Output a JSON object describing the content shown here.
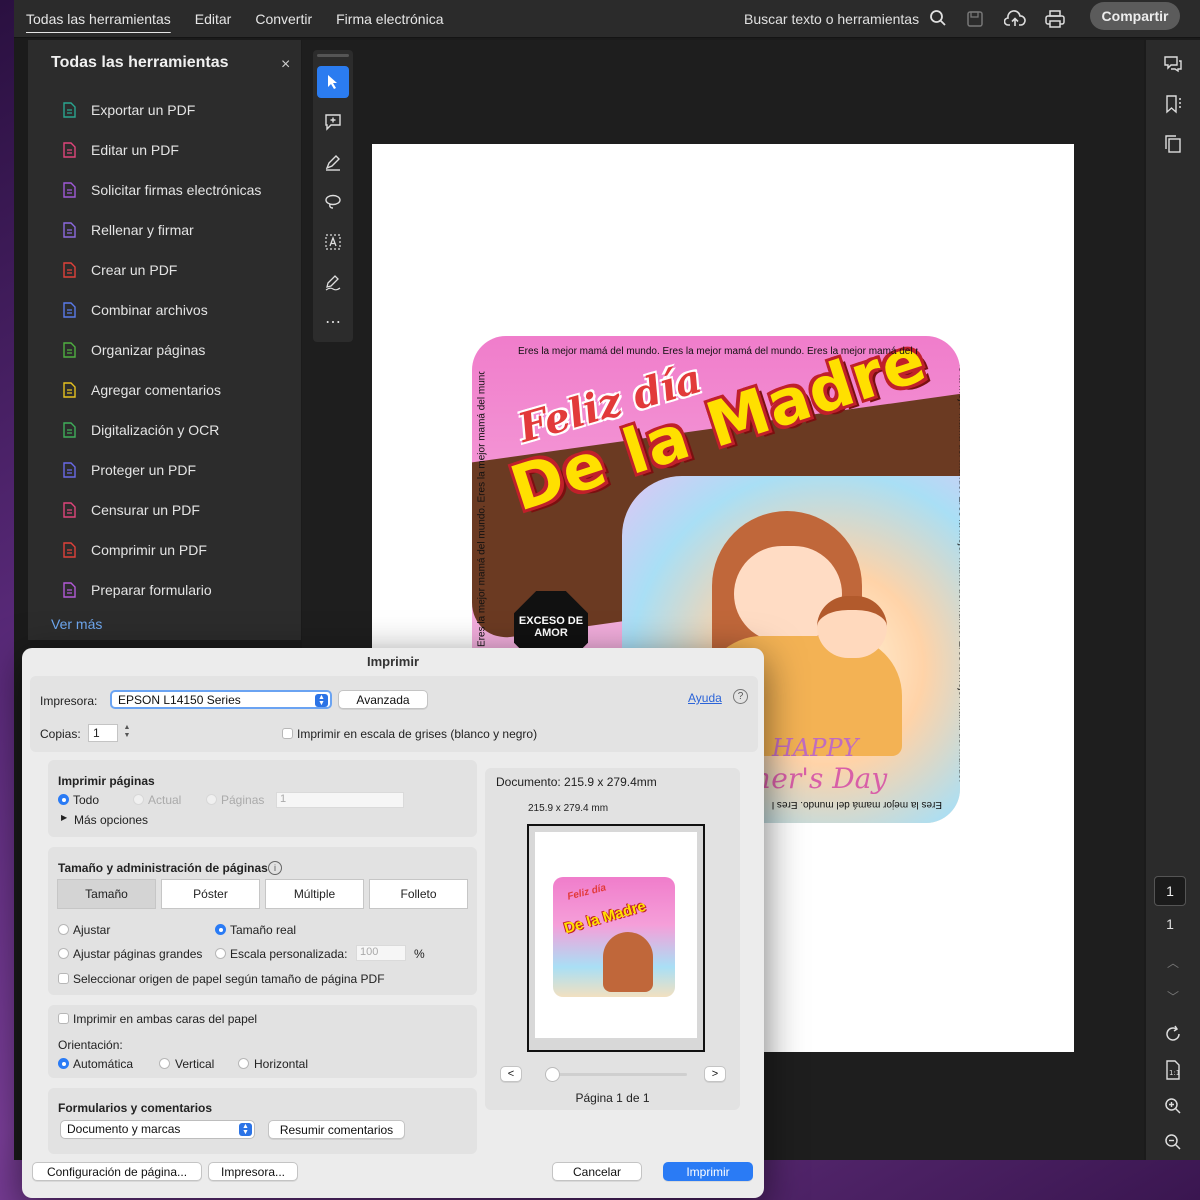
{
  "menubar": {
    "items": [
      "Todas las herramientas",
      "Editar",
      "Convertir",
      "Firma electrónica"
    ],
    "search_label": "Buscar texto o herramientas",
    "share_label": "Compartir"
  },
  "sidebar": {
    "title": "Todas las herramientas",
    "close": "×",
    "tools": [
      {
        "label": "Exportar un PDF",
        "icon": "export-pdf-icon",
        "color": "#2aa58f"
      },
      {
        "label": "Editar un PDF",
        "icon": "edit-pdf-icon",
        "color": "#e0457b"
      },
      {
        "label": "Solicitar firmas electrónicas",
        "icon": "request-signatures-icon",
        "color": "#a05ad8"
      },
      {
        "label": "Rellenar y firmar",
        "icon": "fill-sign-icon",
        "color": "#8d6ae0"
      },
      {
        "label": "Crear un PDF",
        "icon": "create-pdf-icon",
        "color": "#e0413a"
      },
      {
        "label": "Combinar archivos",
        "icon": "combine-files-icon",
        "color": "#5a7bea"
      },
      {
        "label": "Organizar páginas",
        "icon": "organize-pages-icon",
        "color": "#4fb040"
      },
      {
        "label": "Agregar comentarios",
        "icon": "add-comments-icon",
        "color": "#e6c21f"
      },
      {
        "label": "Digitalización y OCR",
        "icon": "scan-ocr-icon",
        "color": "#3fae5a"
      },
      {
        "label": "Proteger un PDF",
        "icon": "protect-pdf-icon",
        "color": "#6a6ae8"
      },
      {
        "label": "Censurar un PDF",
        "icon": "redact-pdf-icon",
        "color": "#e0457b"
      },
      {
        "label": "Comprimir un PDF",
        "icon": "compress-pdf-icon",
        "color": "#e0413a"
      },
      {
        "label": "Preparar formulario",
        "icon": "prepare-form-icon",
        "color": "#b35ad8"
      }
    ],
    "see_more": "Ver más"
  },
  "document": {
    "label_title_1": "Feliz día",
    "label_title_2": "De la Madre",
    "border_text": "Eres la mejor mamá del mundo. Eres la mejor mamá del mundo. Eres la mejor mamá del mundo.",
    "badge_line1": "EXCESO DE",
    "badge_line2": "AMOR",
    "happy_text": "HAPPY",
    "mothers_day_text": "ther's Day"
  },
  "page_nav": {
    "current": "1",
    "total": "1"
  },
  "print_dialog": {
    "title": "Imprimir",
    "printer_label": "Impresora:",
    "printer_value": "EPSON L14150 Series",
    "advanced_button": "Avanzada",
    "help_link": "Ayuda",
    "help_icon": "?",
    "copies_label": "Copias:",
    "copies_value": "1",
    "grayscale_label": "Imprimir en escala de grises (blanco y negro)",
    "pages_section": {
      "title": "Imprimir páginas",
      "all": "Todo",
      "current": "Actual",
      "pages": "Páginas",
      "pages_value": "1",
      "more_options": "Más opciones"
    },
    "size_section": {
      "title": "Tamaño y administración de páginas",
      "tabs": [
        "Tamaño",
        "Póster",
        "Múltiple",
        "Folleto"
      ],
      "fit": "Ajustar",
      "actual_size": "Tamaño real",
      "shrink_large": "Ajustar páginas grandes",
      "custom_scale": "Escala personalizada:",
      "scale_value": "100",
      "percent": "%",
      "paper_source": "Seleccionar origen de papel según tamaño de página PDF"
    },
    "duplex_label": "Imprimir en ambas caras del papel",
    "orientation": {
      "label": "Orientación:",
      "auto": "Automática",
      "portrait": "Vertical",
      "landscape": "Horizontal"
    },
    "forms_section": {
      "title": "Formularios y comentarios",
      "select_value": "Documento y marcas",
      "summarize_button": "Resumir comentarios"
    },
    "preview": {
      "document_size": "Documento: 215.9 x 279.4mm",
      "page_size": "215.9 x 279.4 mm",
      "prev": "<",
      "next": ">",
      "page_info": "Página 1 de 1"
    },
    "page_setup_button": "Configuración de página...",
    "printer_button": "Impresora...",
    "cancel_button": "Cancelar",
    "print_button": "Imprimir"
  }
}
